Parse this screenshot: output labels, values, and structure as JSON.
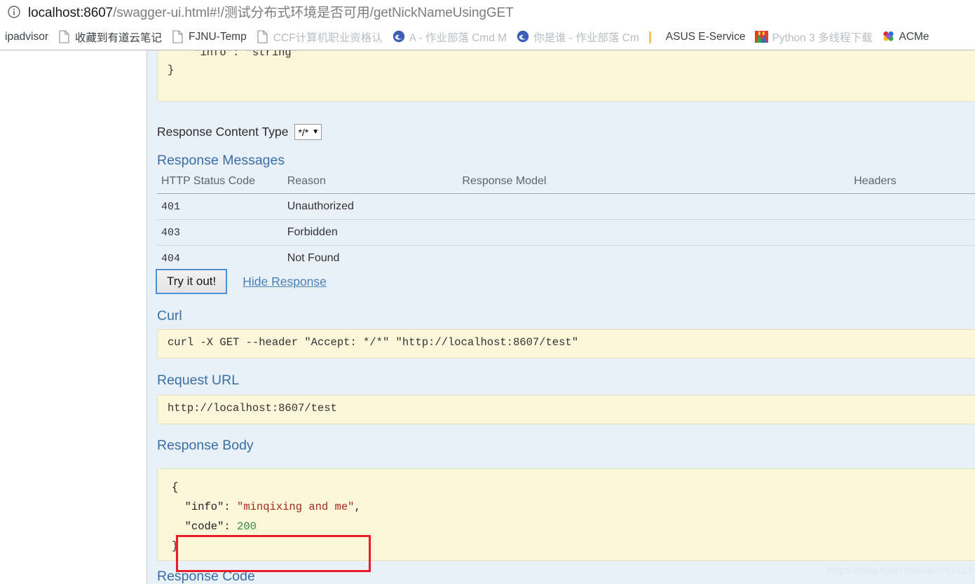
{
  "browser": {
    "site_info_icon": "info-circle-icon",
    "url_scheme_host": "localhost:8607",
    "url_path": "/swagger-ui.html#!/测试分布式环境是否可用/getNickNameUsingGET",
    "bookmarks": [
      {
        "icon": "none",
        "label": "ipadvisor",
        "faded": false
      },
      {
        "icon": "document-icon",
        "label": "收藏到有道云笔记",
        "faded": false
      },
      {
        "icon": "document-icon",
        "label": "FJNU-Temp",
        "faded": false
      },
      {
        "icon": "document-icon",
        "label": "CCF计算机职业资格认",
        "faded": true
      },
      {
        "icon": "edge-icon",
        "label": "A - 作业部落 Cmd M",
        "faded": true
      },
      {
        "icon": "edge-icon",
        "label": "你是谁 - 作业部落 Cm",
        "faded": true
      },
      {
        "icon": "folder-icon",
        "label": "ASUS E-Service",
        "faded": false
      },
      {
        "icon": "python-icon",
        "label": "Python 3 多线程下载",
        "faded": true
      },
      {
        "icon": "acm-icon",
        "label": "ACMe",
        "faded": false
      }
    ]
  },
  "swagger": {
    "model_block": "    \"info\": \"string\"\n}",
    "content_type": {
      "label": "Response Content Type",
      "selected": "*/*",
      "caret": "▼",
      "options": [
        "*/*"
      ]
    },
    "response_messages": {
      "title": "Response Messages",
      "columns": [
        "HTTP Status Code",
        "Reason",
        "Response Model",
        "Headers"
      ],
      "rows": [
        {
          "status": "401",
          "reason": "Unauthorized",
          "model": "",
          "headers": ""
        },
        {
          "status": "403",
          "reason": "Forbidden",
          "model": "",
          "headers": ""
        },
        {
          "status": "404",
          "reason": "Not Found",
          "model": "",
          "headers": ""
        }
      ]
    },
    "actions": {
      "try_it_out": "Try it out!",
      "hide_response": "Hide Response"
    },
    "curl": {
      "title": "Curl",
      "command": "curl -X GET --header \"Accept: */*\" \"http://localhost:8607/test\""
    },
    "request_url": {
      "title": "Request URL",
      "value": "http://localhost:8607/test"
    },
    "response_body": {
      "title": "Response Body",
      "open_brace": "{",
      "line1_key": "  \"info\": ",
      "line1_value": "\"minqixing and me\"",
      "line1_comma": ",",
      "line2_key": "  \"code\": ",
      "line2_value": "200",
      "close_brace": "}"
    },
    "response_code": {
      "title": "Response Code"
    },
    "annotation": {
      "type": "red-rectangle-highlight",
      "color": "#ec1c24",
      "targets": "\"info\": \"minqixing and me\","
    }
  },
  "watermark": "https://blog.csdn.net/xielinrui123"
}
